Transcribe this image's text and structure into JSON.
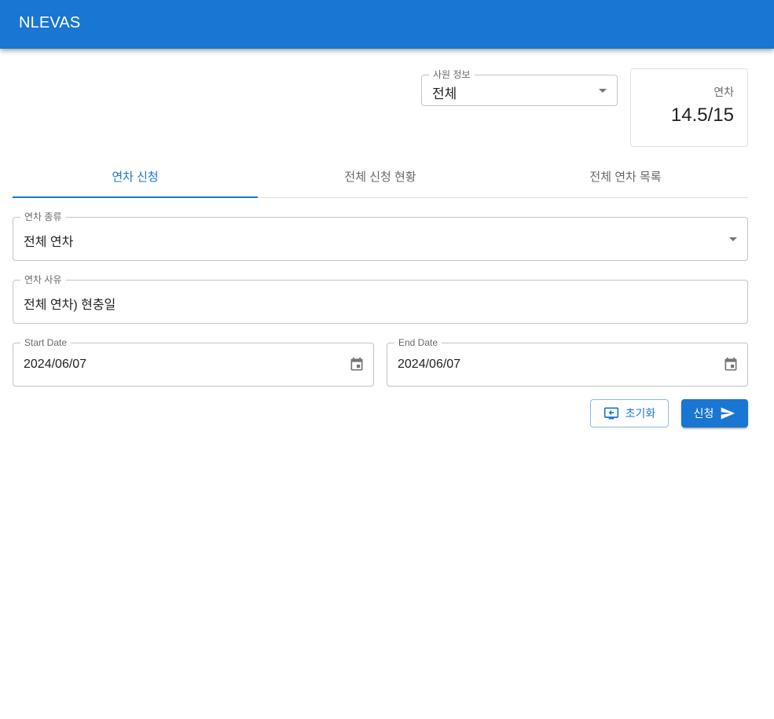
{
  "app": {
    "title": "NLEVAS"
  },
  "employee_select": {
    "label": "사원 정보",
    "value": "전체"
  },
  "leave_balance": {
    "label": "연차",
    "value": "14.5/15"
  },
  "tabs": [
    {
      "label": "연차 신청",
      "active": true
    },
    {
      "label": "전체 신청 현황",
      "active": false
    },
    {
      "label": "전체 연차 목록",
      "active": false
    }
  ],
  "form": {
    "leave_type": {
      "label": "연차 종류",
      "value": "전체 연차"
    },
    "leave_reason": {
      "label": "연차 사유",
      "value": "전체 연차) 현충일"
    },
    "start_date": {
      "label": "Start Date",
      "value": "2024/06/07",
      "icon": "calendar-icon"
    },
    "end_date": {
      "label": "End Date",
      "value": "2024/06/07",
      "icon": "calendar-icon"
    }
  },
  "actions": {
    "reset_label": "초기화",
    "reset_icon": "reset-icon",
    "submit_label": "신청",
    "submit_icon": "send-icon"
  },
  "colors": {
    "primary": "#1976d2",
    "background": "#ffffff"
  }
}
